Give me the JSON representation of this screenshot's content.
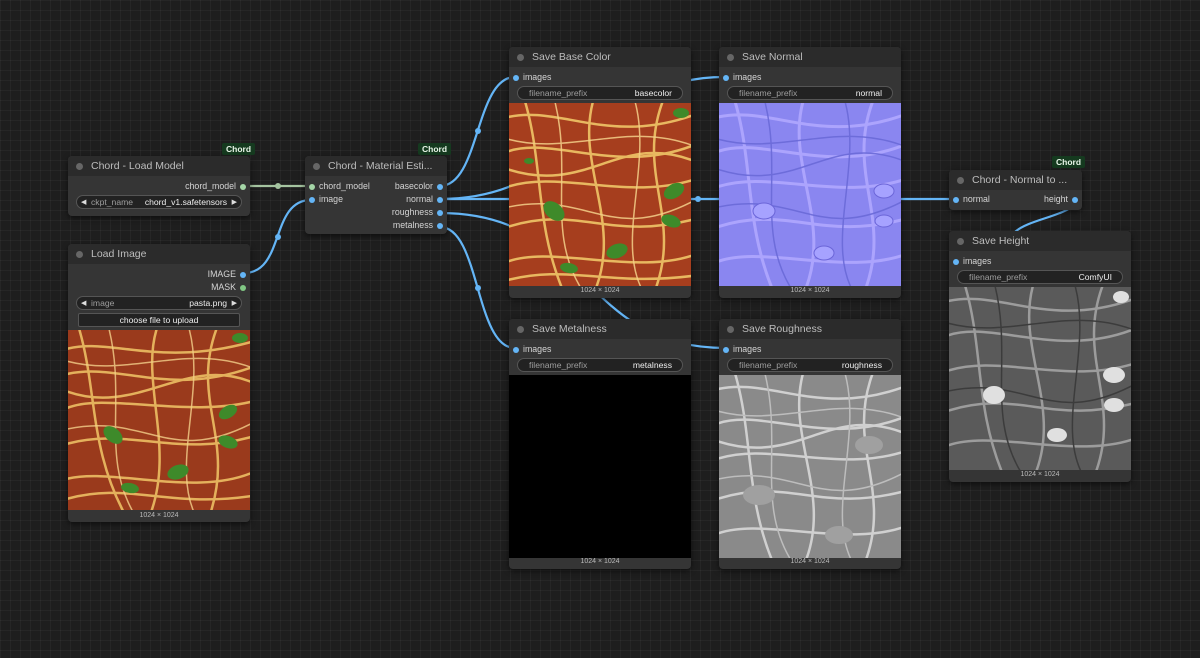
{
  "badge_label": "Chord",
  "nodes": {
    "load_model": {
      "title": "Chord - Load Model",
      "outputs": [
        "chord_model"
      ],
      "widget": {
        "label": "ckpt_name",
        "value": "chord_v1.safetensors"
      }
    },
    "load_image": {
      "title": "Load Image",
      "outputs": [
        "IMAGE",
        "MASK"
      ],
      "widget": {
        "label": "image",
        "value": "pasta.png"
      },
      "button": "choose file to upload",
      "caption": "1024 × 1024"
    },
    "material": {
      "title": "Chord - Material Esti...",
      "inputs": [
        "chord_model",
        "image"
      ],
      "outputs": [
        "basecolor",
        "normal",
        "roughness",
        "metalness"
      ]
    },
    "save_base": {
      "title": "Save Base Color",
      "input": "images",
      "widget": {
        "label": "filename_prefix",
        "value": "basecolor"
      },
      "caption": "1024 × 1024"
    },
    "save_normal": {
      "title": "Save Normal",
      "input": "images",
      "widget": {
        "label": "filename_prefix",
        "value": "normal"
      },
      "caption": "1024 × 1024"
    },
    "save_metal": {
      "title": "Save Metalness",
      "input": "images",
      "widget": {
        "label": "filename_prefix",
        "value": "metalness"
      },
      "caption": "1024 × 1024"
    },
    "save_rough": {
      "title": "Save Roughness",
      "input": "images",
      "widget": {
        "label": "filename_prefix",
        "value": "roughness"
      },
      "caption": "1024 × 1024"
    },
    "normal_to_height": {
      "title": "Chord - Normal to ...",
      "input": "normal",
      "output": "height"
    },
    "save_height": {
      "title": "Save Height",
      "input": "images",
      "widget": {
        "label": "filename_prefix",
        "value": "ComfyUI"
      },
      "caption": "1024 × 1024"
    }
  },
  "colors": {
    "wire_image": "#64b5f6",
    "wire_model": "#a5c4a0",
    "port_image": "#64b5f6",
    "port_model": "#a5d6a7",
    "port_mask": "#81c784",
    "badge_bg": "#153a1f"
  }
}
